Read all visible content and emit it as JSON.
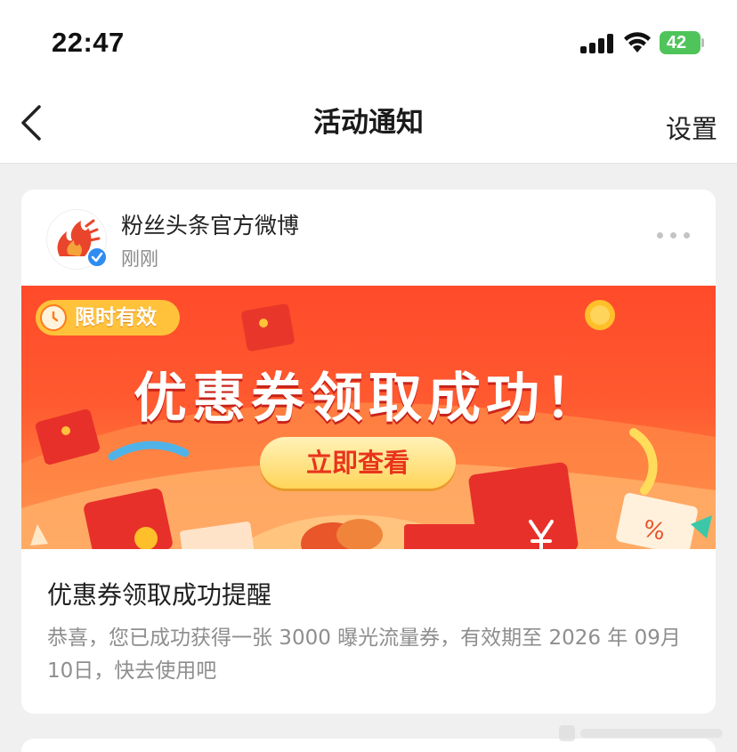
{
  "status_bar": {
    "time": "22:47",
    "battery": "42"
  },
  "nav": {
    "title": "活动通知",
    "settings_label": "设置"
  },
  "message": {
    "sender_name": "粉丝头条官方微博",
    "sent_time": "刚刚",
    "banner": {
      "badge": "限时有效",
      "headline": "优惠券领取成功！",
      "button_label": "立即查看"
    },
    "title": "优惠券领取成功提醒",
    "body": "恭喜，您已成功获得一张 3000 曝光流量券，有效期至 2026 年 09月10日，快去使用吧"
  },
  "colors": {
    "banner_red": "#ff4a2a",
    "button_gold": "#ffd55a",
    "verified_blue": "#2f8cf0",
    "battery_green": "#4fc45a"
  }
}
